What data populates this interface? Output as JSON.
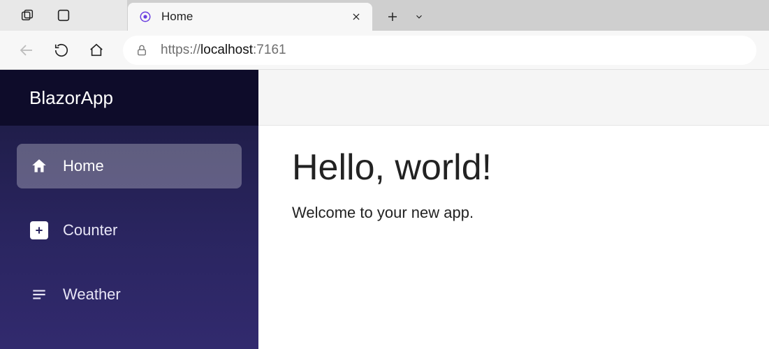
{
  "browser": {
    "tab_title": "Home",
    "url_scheme": "https://",
    "url_host": "localhost",
    "url_port": ":7161"
  },
  "app": {
    "brand": "BlazorApp",
    "nav": {
      "home": "Home",
      "counter": "Counter",
      "weather": "Weather"
    },
    "content": {
      "heading": "Hello, world!",
      "welcome": "Welcome to your new app."
    }
  }
}
